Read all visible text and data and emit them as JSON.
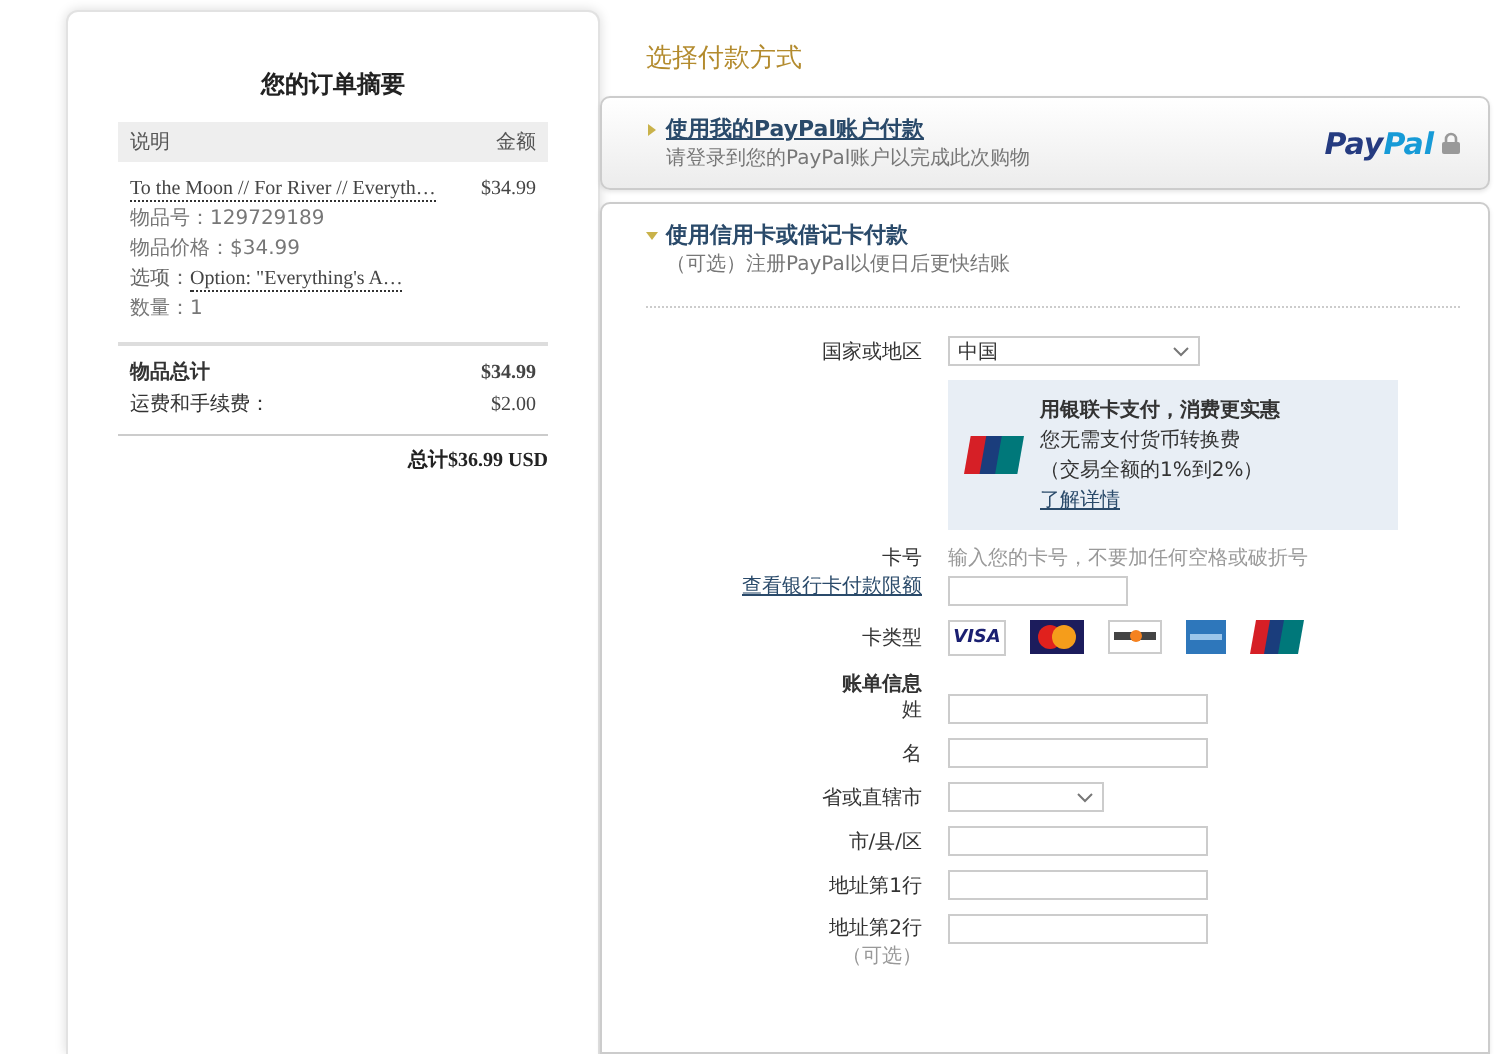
{
  "order_summary": {
    "title": "您的订单摘要",
    "columns": [
      "说明",
      "金额"
    ],
    "item": {
      "name": "To the Moon // For River // Everyth…",
      "price": "$34.99",
      "details": [
        {
          "label": "物品号：",
          "value": "129729189",
          "link": false
        },
        {
          "label": "物品价格：",
          "value": "$34.99",
          "link": false
        },
        {
          "label": "选项：",
          "value": "Option: \"Everything's A…",
          "link": true
        },
        {
          "label": "数量：",
          "value": "1",
          "link": false
        }
      ]
    },
    "subtotal": {
      "label": "物品总计",
      "value": "$34.99"
    },
    "shipping": {
      "label": "运费和手续费：",
      "value": "$2.00"
    },
    "total": "总计$36.99 USD"
  },
  "payment": {
    "title": "选择付款方式",
    "paypal_option": {
      "title": "使用我的PayPal账户付款",
      "subtitle": "请登录到您的PayPal账户以完成此次购物",
      "logo": [
        "Pay",
        "Pal"
      ],
      "expanded": false
    },
    "card_option": {
      "title": "使用信用卡或借记卡付款",
      "subtitle": "（可选）注册PayPal以便日后更快结账",
      "expanded": true
    },
    "country": {
      "label": "国家或地区",
      "value": "中国"
    },
    "unionpay_promo": {
      "title": "用银联卡支付，消费更实惠",
      "lines": [
        "您无需支付货币转换费",
        "（交易全额的1%到2%）"
      ],
      "link": "了解详情"
    },
    "card_number": {
      "label": "卡号",
      "link": "查看银行卡付款限额",
      "hint": "输入您的卡号，不要加任何空格或破折号"
    },
    "card_type": {
      "label": "卡类型",
      "cards": [
        {
          "kind": "visa",
          "label": "VISA"
        },
        {
          "kind": "mastercard"
        },
        {
          "kind": "discover"
        },
        {
          "kind": "amex"
        },
        {
          "kind": "unionpay"
        }
      ]
    },
    "billing": {
      "heading": "账单信息",
      "fields": [
        {
          "kind": "text",
          "label": "姓"
        },
        {
          "kind": "text",
          "label": "名"
        },
        {
          "kind": "select",
          "label": "省或直辖市"
        },
        {
          "kind": "text",
          "label": "市/县/区"
        },
        {
          "kind": "text",
          "label": "地址第1行"
        },
        {
          "kind": "text",
          "label": "地址第2行",
          "note": "（可选）"
        }
      ]
    }
  }
}
